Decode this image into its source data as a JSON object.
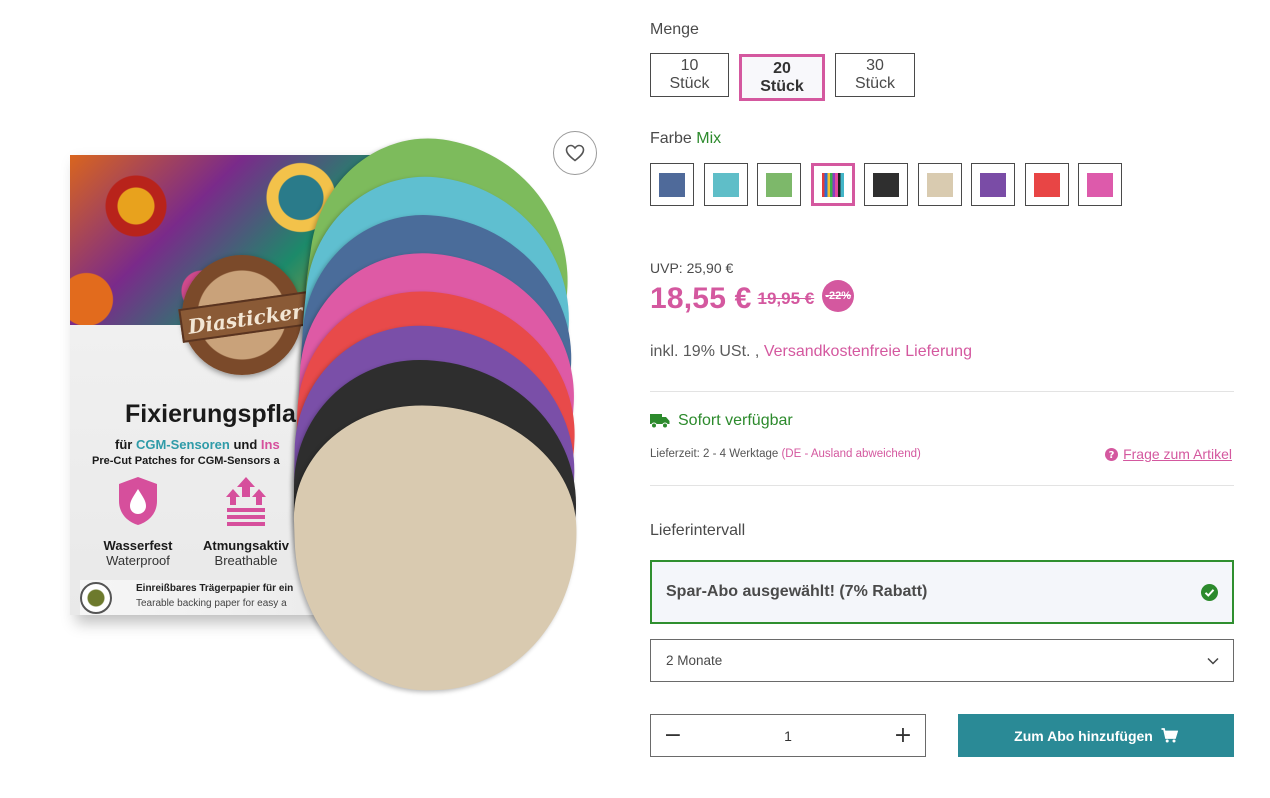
{
  "product_image": {
    "box": {
      "badge_text": "Diasticker",
      "title": "Fixierungspfla",
      "subtitle_prefix": "für ",
      "subtitle_cgm": "CGM-Sensoren",
      "subtitle_und": " und ",
      "subtitle_ins": "Ins",
      "subtitle_en": "Pre-Cut Patches for CGM-Sensors a",
      "features": [
        {
          "label_de": "Wasserfest",
          "label_en": "Waterproof"
        },
        {
          "label_de": "Atmungsaktiv",
          "label_en": "Breathable"
        }
      ],
      "strip_de": "Einreißbares Trägerpapier für ein",
      "strip_en": "Tearable backing paper for easy a"
    },
    "patch_colors": [
      "#7dbb5c",
      "#5fbfd0",
      "#4a6c9a",
      "#de5aa5",
      "#e84a4a",
      "#7a4fa8",
      "#2e2e2e",
      "#d9cab0"
    ],
    "wishlist_icon": "heart-outline-icon"
  },
  "quantity": {
    "label": "Menge",
    "options": [
      {
        "label": "10 Stück",
        "selected": false
      },
      {
        "label": "20 Stück",
        "selected": true
      },
      {
        "label": "30 Stück",
        "selected": false
      }
    ]
  },
  "color": {
    "label": "Farbe",
    "selected_value": "Mix",
    "swatches": [
      {
        "name": "blue",
        "hex": "#4f6a9a",
        "selected": false
      },
      {
        "name": "turquoise",
        "hex": "#5fbec8",
        "selected": false
      },
      {
        "name": "green",
        "hex": "#7db86a",
        "selected": false
      },
      {
        "name": "mix",
        "hex": "multi",
        "selected": true
      },
      {
        "name": "black",
        "hex": "#2f2f2f",
        "selected": false
      },
      {
        "name": "beige",
        "hex": "#d9cbb0",
        "selected": false
      },
      {
        "name": "purple",
        "hex": "#7a4ca6",
        "selected": false
      },
      {
        "name": "red",
        "hex": "#e84545",
        "selected": false
      },
      {
        "name": "pink",
        "hex": "#dd5aab",
        "selected": false
      }
    ]
  },
  "pricing": {
    "uvp": "UVP: 25,90 €",
    "price": "18,55 €",
    "old_price": "19,95 €",
    "discount": "-22%",
    "tax": "inkl. 19% USt. ,",
    "shipping_link": "Versandkostenfreie Lieferung"
  },
  "availability": {
    "status": "Sofort verfügbar",
    "delivery_time": "Lieferzeit: 2 - 4 Werktage",
    "delivery_note": "(DE - Ausland abweichend)",
    "question_link": "Frage zum Artikel"
  },
  "subscription": {
    "interval_label": "Lieferintervall",
    "abo_text": "Spar-Abo ausgewählt! (7% Rabatt)",
    "interval_value": "2 Monate"
  },
  "cart": {
    "quantity": "1",
    "minus": "−",
    "plus": "+",
    "button_label": "Zum Abo hinzufügen"
  },
  "colors": {
    "accent_pink": "#d4589f",
    "success_green": "#2c8a2c",
    "cta_teal": "#2a8a96"
  }
}
